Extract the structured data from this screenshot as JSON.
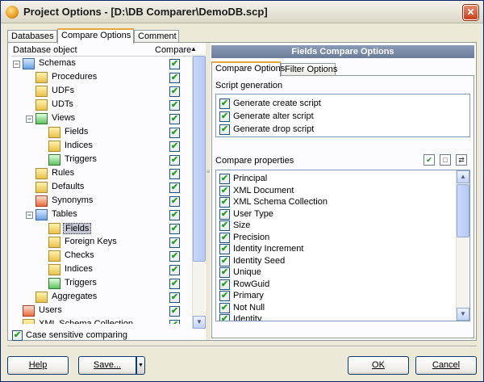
{
  "window": {
    "title": "Project Options - [D:\\DB Comparer\\DemoDB.scp]",
    "close_glyph": "✕"
  },
  "main_tabs": [
    {
      "label": "Databases"
    },
    {
      "label": "Compare Options",
      "active": true
    },
    {
      "label": "Comment"
    }
  ],
  "tree": {
    "col_object": "Database object",
    "col_compare": "Compare",
    "rows": [
      {
        "label": "Schemas",
        "level": 0,
        "expander": "−",
        "icon": "schemas-icon",
        "checked": true
      },
      {
        "label": "Procedures",
        "level": 1,
        "icon": "procedures-icon",
        "checked": true
      },
      {
        "label": "UDFs",
        "level": 1,
        "icon": "udfs-icon",
        "checked": true
      },
      {
        "label": "UDTs",
        "level": 1,
        "icon": "udts-icon",
        "checked": true
      },
      {
        "label": "Views",
        "level": 1,
        "expander": "−",
        "icon": "views-icon",
        "checked": true
      },
      {
        "label": "Fields",
        "level": 2,
        "icon": "fields-icon",
        "checked": true
      },
      {
        "label": "Indices",
        "level": 2,
        "icon": "indices-icon",
        "checked": true
      },
      {
        "label": "Triggers",
        "level": 2,
        "icon": "triggers-icon",
        "checked": true
      },
      {
        "label": "Rules",
        "level": 1,
        "icon": "rules-icon",
        "checked": true
      },
      {
        "label": "Defaults",
        "level": 1,
        "icon": "defaults-icon",
        "checked": true
      },
      {
        "label": "Synonyms",
        "level": 1,
        "icon": "synonyms-icon",
        "checked": true
      },
      {
        "label": "Tables",
        "level": 1,
        "expander": "−",
        "icon": "tables-icon",
        "checked": true
      },
      {
        "label": "Fields",
        "level": 2,
        "icon": "fields-icon",
        "checked": true,
        "selected": true
      },
      {
        "label": "Foreign Keys",
        "level": 2,
        "icon": "foreign-keys-icon",
        "checked": true
      },
      {
        "label": "Checks",
        "level": 2,
        "icon": "checks-icon",
        "checked": true
      },
      {
        "label": "Indices",
        "level": 2,
        "icon": "indices-icon",
        "checked": true
      },
      {
        "label": "Triggers",
        "level": 2,
        "icon": "triggers-icon",
        "checked": true
      },
      {
        "label": "Aggregates",
        "level": 1,
        "icon": "aggregates-icon",
        "checked": true
      },
      {
        "label": "Users",
        "level": 0,
        "icon": "users-icon",
        "checked": true
      },
      {
        "label": "XML Schema Collection",
        "level": 0,
        "icon": "xml-icon",
        "checked": true
      }
    ]
  },
  "right": {
    "header": "Fields Compare Options",
    "sub_tabs": [
      {
        "label": "Compare Options",
        "active": true
      },
      {
        "label": "Filter Options"
      }
    ],
    "script_generation": {
      "label": "Script generation",
      "options": [
        {
          "label": "Generate create script",
          "checked": true
        },
        {
          "label": "Generate alter script",
          "checked": true
        },
        {
          "label": "Generate drop script",
          "checked": true
        }
      ]
    },
    "compare_properties": {
      "label": "Compare properties",
      "items": [
        {
          "label": "Principal",
          "checked": true
        },
        {
          "label": "XML Document",
          "checked": true
        },
        {
          "label": "XML Schema Collection",
          "checked": true
        },
        {
          "label": "User Type",
          "checked": true
        },
        {
          "label": "Size",
          "checked": true
        },
        {
          "label": "Precision",
          "checked": true
        },
        {
          "label": "Identity Increment",
          "checked": true
        },
        {
          "label": "Identity Seed",
          "checked": true
        },
        {
          "label": "Unique",
          "checked": true
        },
        {
          "label": "RowGuid",
          "checked": true
        },
        {
          "label": "Primary",
          "checked": true
        },
        {
          "label": "Not Null",
          "checked": true
        },
        {
          "label": "Identity",
          "checked": true
        }
      ]
    }
  },
  "footer": {
    "case_sensitive": {
      "label": "Case sensitive comparing",
      "checked": true
    },
    "help": "Help",
    "save": "Save...",
    "ok": "OK",
    "cancel": "Cancel"
  },
  "glyphs": {
    "check": "✔",
    "up": "▲",
    "down": "▼",
    "grip": "≡"
  }
}
